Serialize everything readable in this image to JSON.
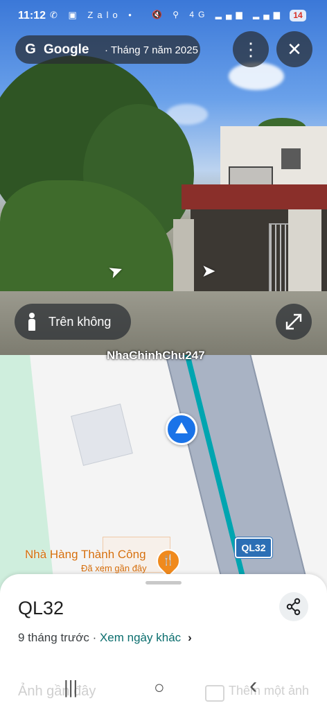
{
  "status_bar": {
    "time": "11:12",
    "app_icons": "✆ ▣ Zalo •",
    "sys_icons": "🔇 ⚲ 4G ▂▄▆ ▂▄▆",
    "battery": "14"
  },
  "streetview": {
    "brand": "Google",
    "separator": "·",
    "date": "Tháng 7 năm 2025",
    "menu_icon": "⋮",
    "close_icon": "✕",
    "view_mode_label": "Trên không",
    "watermark": "NhaChinhChu247"
  },
  "map": {
    "road_shield": "QL32",
    "poi_name": "Nhà Hàng Thành Công",
    "poi_subtitle": "Đã xem gần đây",
    "poi_icon": "🍴"
  },
  "sheet": {
    "title": "QL32",
    "time_ago": "9 tháng trước",
    "separator": " · ",
    "other_dates_link": "Xem ngày khác",
    "chevron": "›",
    "recent_photos": "Ảnh gần đây",
    "add_photo": "Thêm một ảnh"
  },
  "navbar": {
    "recents": "|||",
    "home": "○",
    "back": "‹"
  }
}
